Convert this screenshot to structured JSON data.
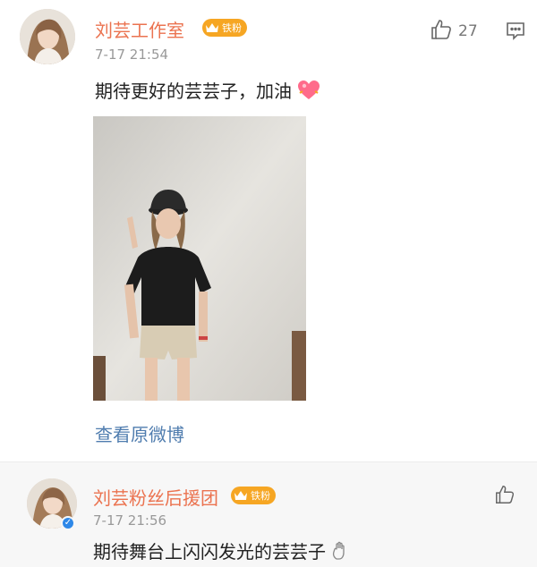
{
  "comments": [
    {
      "author": "刘芸工作室",
      "badge": "铁粉",
      "time": "7-17 21:54",
      "text": "期待更好的芸芸子，加油",
      "emoji": "heart-emoji",
      "likes": "27",
      "link": "查看原微博"
    },
    {
      "author": "刘芸粉丝后援团",
      "badge": "铁粉",
      "time": "7-17 21:56",
      "text": "期待舞台上闪闪发光的芸芸子",
      "emoji": "hand-emoji"
    }
  ],
  "colors": {
    "author_name": "#eb7350",
    "badge": "#f6a623",
    "link": "#507daf",
    "verified": "#2e88e8"
  }
}
